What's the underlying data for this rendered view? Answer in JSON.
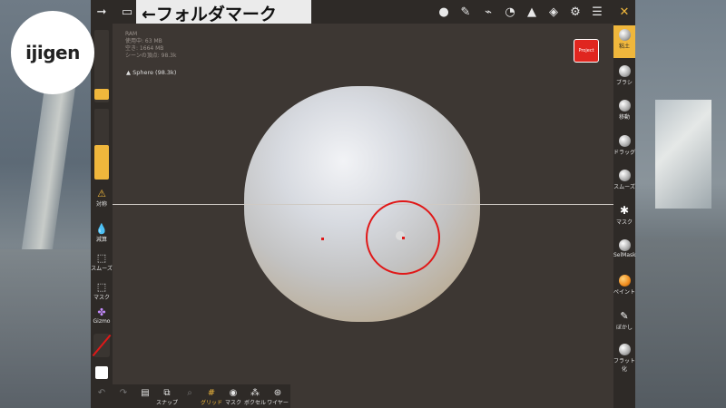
{
  "logo": {
    "text": "ijigen"
  },
  "folder_label": "←フォルダマーク",
  "project_button": "Project",
  "ram_info": [
    "RAM",
    "使用中: 63 MB",
    "空き: 1664 MB",
    "シーンの頂点: 98.3k"
  ],
  "object_label": "Sphere (98.3k)",
  "topbar_icons": [
    "arrow-icon",
    "folder-icon",
    "material-ball-icon",
    "pen-icon",
    "dropper-icon",
    "camera-icon",
    "prism-icon",
    "layers-icon",
    "gear-icon",
    "menu-icon",
    "tools-icon"
  ],
  "left_sliders": {
    "radius": 0.1,
    "intensity": 0.45
  },
  "left_tools": [
    {
      "label": "対称",
      "icon": "symmetry-icon"
    },
    {
      "label": "減算",
      "icon": "drop-icon"
    },
    {
      "label": "スムーズ",
      "icon": "smooth-icon"
    },
    {
      "label": "マスク",
      "icon": "mask-icon"
    },
    {
      "label": "Gizmo",
      "icon": "gizmo-icon"
    }
  ],
  "right_tools": [
    {
      "label": "粘土",
      "active": true
    },
    {
      "label": "ブラシ"
    },
    {
      "label": "移動"
    },
    {
      "label": "ドラッグ"
    },
    {
      "label": "スムーズ"
    },
    {
      "label": "マスク"
    },
    {
      "label": "SelMask"
    },
    {
      "label": "ペイント"
    },
    {
      "label": "ぼかし"
    },
    {
      "label": "フラット化"
    }
  ],
  "bottom_tools": [
    {
      "label": "",
      "icon": "undo-icon"
    },
    {
      "label": "",
      "icon": "redo-icon"
    },
    {
      "label": "",
      "icon": "doc-icon"
    },
    {
      "label": "スナップ",
      "icon": "snapshot-icon"
    },
    {
      "label": "",
      "icon": "search-icon"
    },
    {
      "label": "グリッド",
      "icon": "grid-icon"
    },
    {
      "label": "マスク",
      "icon": "eye-icon"
    },
    {
      "label": "ボクセル",
      "icon": "voxel-icon"
    },
    {
      "label": "ワイヤー",
      "icon": "wire-icon"
    }
  ],
  "colors": {
    "accent": "#f0b73c",
    "brush_ring": "#e01818",
    "project": "#e0261f"
  }
}
